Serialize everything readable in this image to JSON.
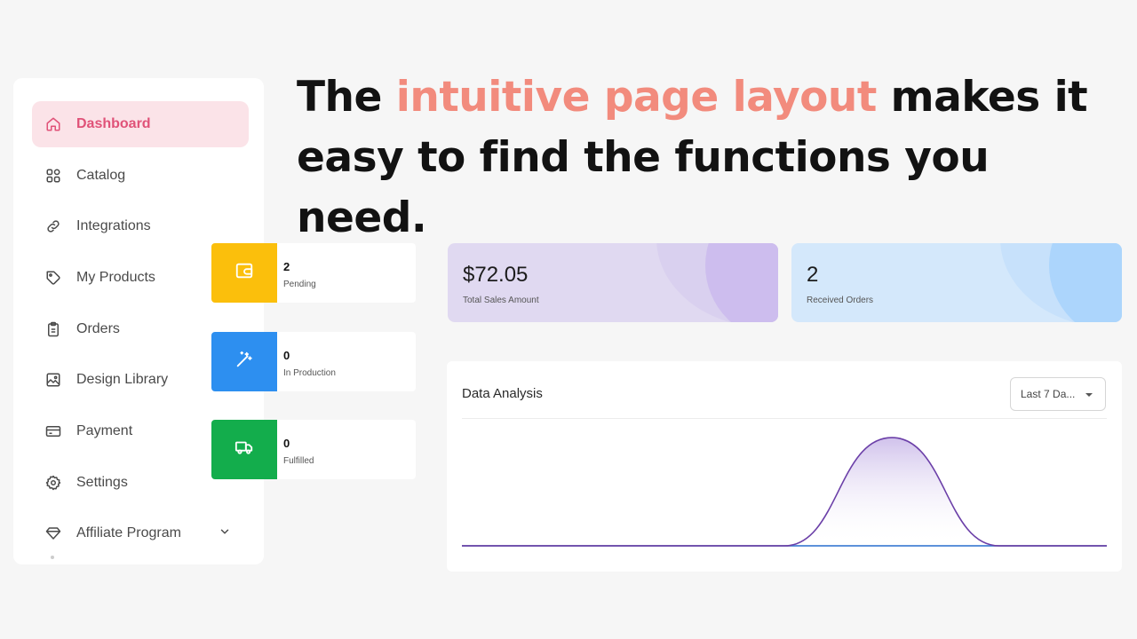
{
  "headline": {
    "before": "The ",
    "accent": "intuitive page layout",
    "after": " makes it easy to find the functions you need.",
    "accent_color": "#f28b7d"
  },
  "sidebar": {
    "items": [
      {
        "label": "Dashboard",
        "icon": "home-icon",
        "active": true
      },
      {
        "label": "Catalog",
        "icon": "grid-icon"
      },
      {
        "label": "Integrations",
        "icon": "link-icon"
      },
      {
        "label": "My Products",
        "icon": "tag-icon"
      },
      {
        "label": "Orders",
        "icon": "clipboard-icon"
      },
      {
        "label": "Design Library",
        "icon": "image-icon"
      },
      {
        "label": "Payment",
        "icon": "credit-card-icon"
      },
      {
        "label": "Settings",
        "icon": "gear-icon"
      },
      {
        "label": "Affiliate Program",
        "icon": "diamond-icon",
        "expandable": true
      }
    ],
    "active_color": "#e05278",
    "active_bg": "#fbe3e8"
  },
  "status_cards": [
    {
      "count": "2",
      "label": "Pending",
      "color": "#fbbf0c",
      "icon": "wallet-icon"
    },
    {
      "count": "0",
      "label": "In Production",
      "color": "#2d8ff0",
      "icon": "magic-wand-icon"
    },
    {
      "count": "0",
      "label": "Fulfilled",
      "color": "#13ad4c",
      "icon": "truck-icon"
    }
  ],
  "stats": [
    {
      "value": "$72.05",
      "label": "Total Sales Amount",
      "bg": "#e0d9f1",
      "accent": "#cdbdee"
    },
    {
      "value": "2",
      "label": "Received Orders",
      "bg": "#d4e8fb",
      "accent": "#acd5fc"
    }
  ],
  "analysis": {
    "title": "Data Analysis",
    "range_value": "Last 7 Da..."
  },
  "chart_data": {
    "type": "area",
    "title": "",
    "x": [
      0,
      1,
      2,
      3,
      4,
      5,
      6
    ],
    "series": [
      {
        "values": [
          0,
          0,
          0,
          0,
          1,
          0,
          0
        ],
        "color": "#6b3fa8"
      },
      {
        "values": [
          0,
          0,
          0,
          0,
          0,
          0,
          0
        ],
        "color": "#2d8ff0"
      },
      {
        "values": [
          0,
          0,
          0,
          0,
          0,
          0,
          0
        ],
        "color": "#e0302f"
      }
    ],
    "ylim": [
      0,
      1.05
    ],
    "grid": false
  }
}
